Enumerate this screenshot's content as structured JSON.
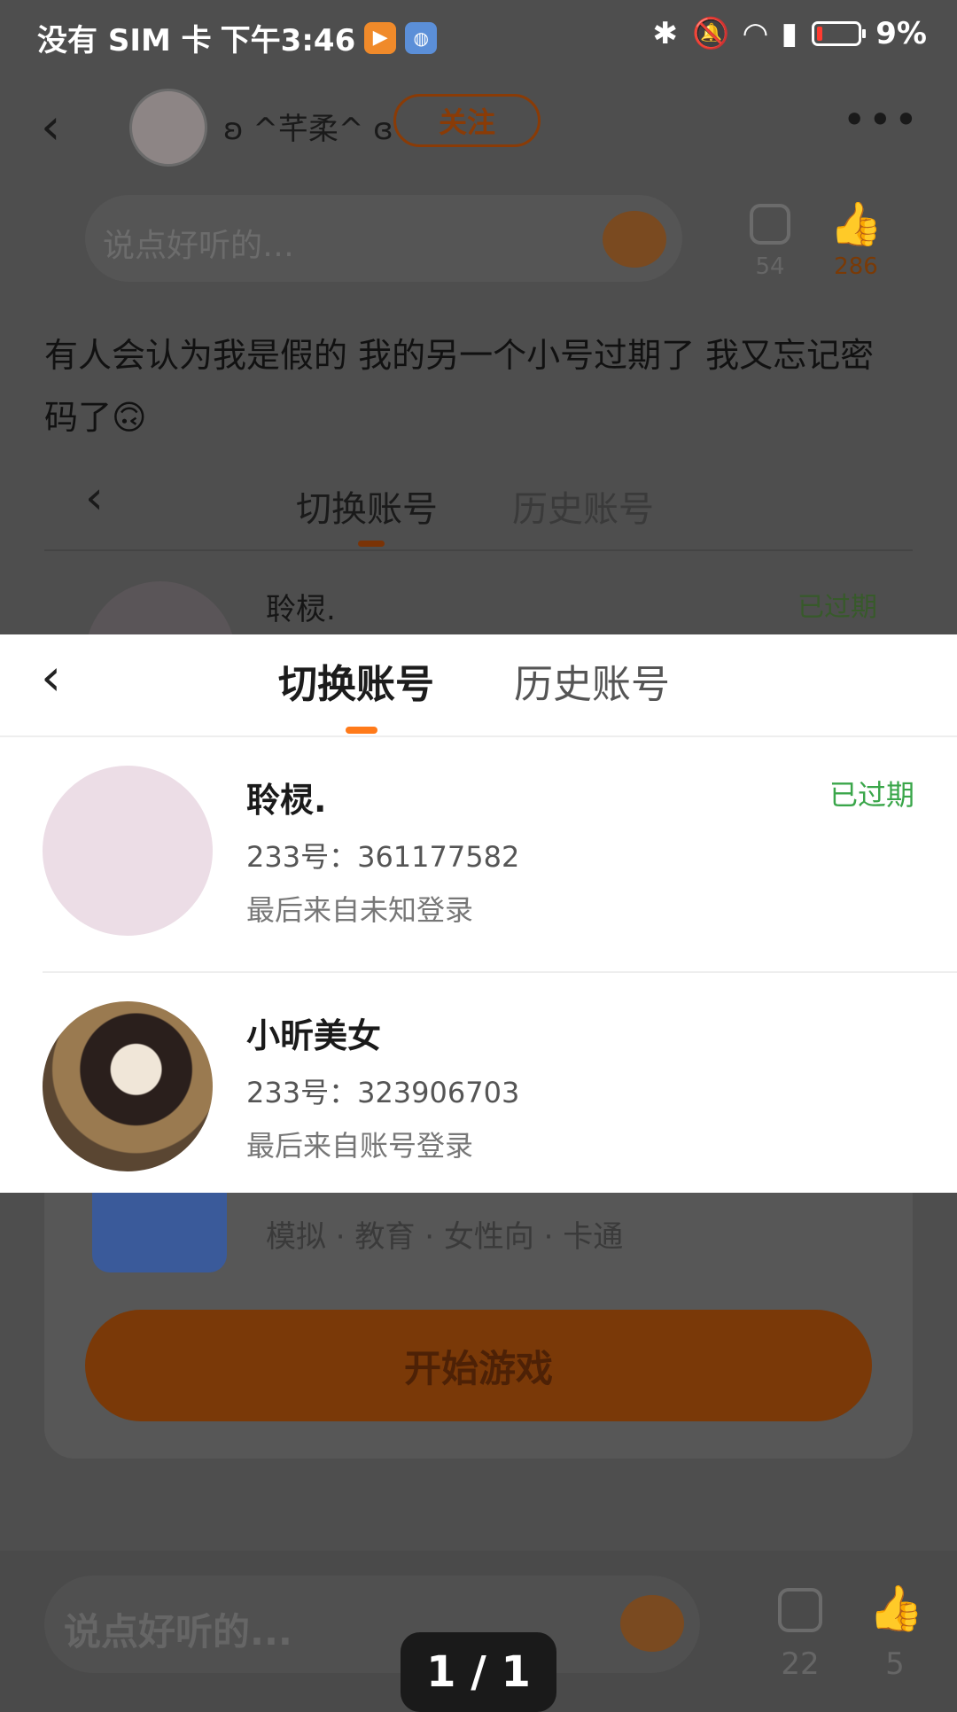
{
  "status_bar": {
    "carrier": "没有 SIM 卡",
    "time": "下午3:46",
    "battery": "9%"
  },
  "header": {
    "nickname": "ʚ ^芊柔^ ɞ",
    "follow_label": "关注",
    "more_label": "•••"
  },
  "comment_bar_top": {
    "placeholder": "说点好听的…",
    "comments": "54",
    "likes": "286"
  },
  "post": {
    "text": "有人会认为我是假的 我的另一个小号过期了 我又忘记密码了🙃"
  },
  "background_tabs": {
    "tab1": "切换账号",
    "tab2": "历史账号",
    "row_name": "聆棂.",
    "row_status": "已过期"
  },
  "account_sheet": {
    "tabs": [
      "切换账号",
      "历史账号"
    ],
    "accounts": [
      {
        "name": "聆棂.",
        "id": "233号：361177582",
        "source": "最后来自未知登录",
        "status": "已过期"
      },
      {
        "name": "小昕美女",
        "id": "233号：323906703",
        "source": "最后来自账号登录",
        "status": ""
      }
    ]
  },
  "game_card": {
    "tags": "模拟 · 教育 · 女性向 · 卡通",
    "play_label": "开始游戏"
  },
  "bottom_bar": {
    "placeholder": "说点好听的...",
    "comments": "22",
    "likes": "5",
    "pager": "1 / 1"
  },
  "colors": {
    "accent": "#ff7a1a",
    "expired_green": "#3aa64a"
  }
}
